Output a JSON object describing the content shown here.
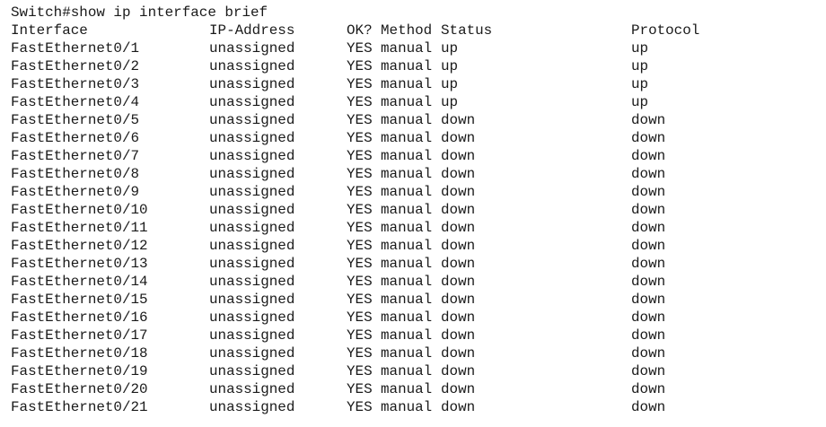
{
  "prompt_line": "Switch#show ip interface brief",
  "headers": {
    "interface": "Interface",
    "ip_address": "IP-Address",
    "ok": "OK?",
    "method": "Method",
    "status": "Status",
    "protocol": "Protocol"
  },
  "rows": [
    {
      "interface": "FastEthernet0/1",
      "ip_address": "unassigned",
      "ok": "YES",
      "method": "manual",
      "status": "up",
      "protocol": "up"
    },
    {
      "interface": "FastEthernet0/2",
      "ip_address": "unassigned",
      "ok": "YES",
      "method": "manual",
      "status": "up",
      "protocol": "up"
    },
    {
      "interface": "FastEthernet0/3",
      "ip_address": "unassigned",
      "ok": "YES",
      "method": "manual",
      "status": "up",
      "protocol": "up"
    },
    {
      "interface": "FastEthernet0/4",
      "ip_address": "unassigned",
      "ok": "YES",
      "method": "manual",
      "status": "up",
      "protocol": "up"
    },
    {
      "interface": "FastEthernet0/5",
      "ip_address": "unassigned",
      "ok": "YES",
      "method": "manual",
      "status": "down",
      "protocol": "down"
    },
    {
      "interface": "FastEthernet0/6",
      "ip_address": "unassigned",
      "ok": "YES",
      "method": "manual",
      "status": "down",
      "protocol": "down"
    },
    {
      "interface": "FastEthernet0/7",
      "ip_address": "unassigned",
      "ok": "YES",
      "method": "manual",
      "status": "down",
      "protocol": "down"
    },
    {
      "interface": "FastEthernet0/8",
      "ip_address": "unassigned",
      "ok": "YES",
      "method": "manual",
      "status": "down",
      "protocol": "down"
    },
    {
      "interface": "FastEthernet0/9",
      "ip_address": "unassigned",
      "ok": "YES",
      "method": "manual",
      "status": "down",
      "protocol": "down"
    },
    {
      "interface": "FastEthernet0/10",
      "ip_address": "unassigned",
      "ok": "YES",
      "method": "manual",
      "status": "down",
      "protocol": "down"
    },
    {
      "interface": "FastEthernet0/11",
      "ip_address": "unassigned",
      "ok": "YES",
      "method": "manual",
      "status": "down",
      "protocol": "down"
    },
    {
      "interface": "FastEthernet0/12",
      "ip_address": "unassigned",
      "ok": "YES",
      "method": "manual",
      "status": "down",
      "protocol": "down"
    },
    {
      "interface": "FastEthernet0/13",
      "ip_address": "unassigned",
      "ok": "YES",
      "method": "manual",
      "status": "down",
      "protocol": "down"
    },
    {
      "interface": "FastEthernet0/14",
      "ip_address": "unassigned",
      "ok": "YES",
      "method": "manual",
      "status": "down",
      "protocol": "down"
    },
    {
      "interface": "FastEthernet0/15",
      "ip_address": "unassigned",
      "ok": "YES",
      "method": "manual",
      "status": "down",
      "protocol": "down"
    },
    {
      "interface": "FastEthernet0/16",
      "ip_address": "unassigned",
      "ok": "YES",
      "method": "manual",
      "status": "down",
      "protocol": "down"
    },
    {
      "interface": "FastEthernet0/17",
      "ip_address": "unassigned",
      "ok": "YES",
      "method": "manual",
      "status": "down",
      "protocol": "down"
    },
    {
      "interface": "FastEthernet0/18",
      "ip_address": "unassigned",
      "ok": "YES",
      "method": "manual",
      "status": "down",
      "protocol": "down"
    },
    {
      "interface": "FastEthernet0/19",
      "ip_address": "unassigned",
      "ok": "YES",
      "method": "manual",
      "status": "down",
      "protocol": "down"
    },
    {
      "interface": "FastEthernet0/20",
      "ip_address": "unassigned",
      "ok": "YES",
      "method": "manual",
      "status": "down",
      "protocol": "down"
    },
    {
      "interface": "FastEthernet0/21",
      "ip_address": "unassigned",
      "ok": "YES",
      "method": "manual",
      "status": "down",
      "protocol": "down"
    }
  ]
}
